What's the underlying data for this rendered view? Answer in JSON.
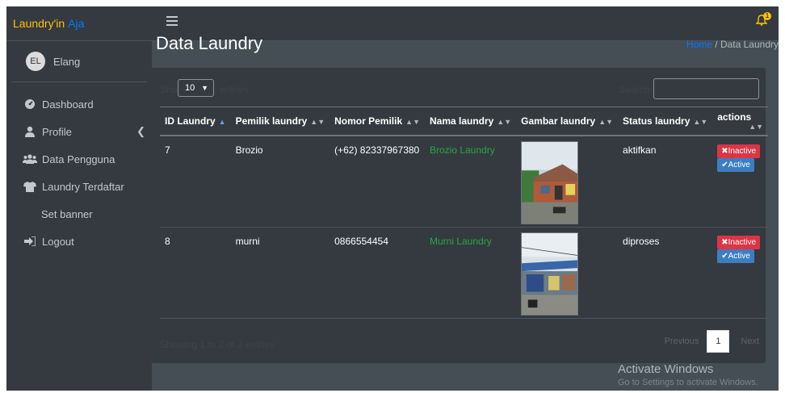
{
  "brand": {
    "part1": "Laundry'in",
    "part2": "Aja"
  },
  "user": {
    "initials": "EL",
    "name": "Elang"
  },
  "sidebar": {
    "items": [
      {
        "label": "Dashboard",
        "icon": "dashboard-icon"
      },
      {
        "label": "Profile",
        "icon": "user-icon"
      },
      {
        "label": "Data Pengguna",
        "icon": "users-icon"
      },
      {
        "label": "Laundry Terdaftar",
        "icon": "tshirt-icon"
      },
      {
        "label": "Set banner"
      },
      {
        "label": "Logout",
        "icon": "logout-icon"
      }
    ]
  },
  "topbar": {
    "notification_count": "1"
  },
  "page": {
    "title": "Data Laundry",
    "breadcrumb_home": "Home",
    "breadcrumb_sep": "/",
    "breadcrumb_current": "Data Laundry"
  },
  "table_controls": {
    "show_label": "Show",
    "page_size": "10",
    "entries_label": "entries",
    "search_label": "Search:"
  },
  "table": {
    "headers": [
      "ID Laundry",
      "Pemilik laundry",
      "Nomor Pemilik",
      "Nama laundry",
      "Gambar laundry",
      "Status laundry",
      "actions"
    ],
    "rows": [
      {
        "id": "7",
        "owner": "Brozio",
        "phone": "(+62) 82337967380",
        "name": "Brozio Laundry",
        "status": "aktifkan",
        "btn_inactive": "Inactive",
        "btn_active": "Active"
      },
      {
        "id": "8",
        "owner": "murni",
        "phone": "0866554454",
        "name": "Murni Laundry",
        "status": "diproses",
        "btn_inactive": "Inactive",
        "btn_active": "Active"
      }
    ]
  },
  "footer": {
    "info": "Showing 1 to 2 of 2 entries",
    "prev": "Previous",
    "page": "1",
    "next": "Next"
  },
  "watermark": {
    "line1": "Activate Windows",
    "line2": "Go to Settings to activate Windows."
  }
}
